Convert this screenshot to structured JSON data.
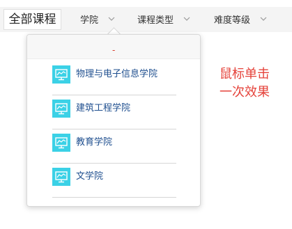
{
  "filter_bar": {
    "all_courses_label": "全部课程",
    "filters": [
      {
        "label": "学院"
      },
      {
        "label": "课程类型"
      },
      {
        "label": "难度等级"
      }
    ]
  },
  "dropdown": {
    "marker": "-",
    "options": [
      {
        "label": "物理与电子信息学院",
        "icon": "presentation-screen-icon"
      },
      {
        "label": "建筑工程学院",
        "icon": "presentation-screen-icon"
      },
      {
        "label": "教育学院",
        "icon": "presentation-screen-icon"
      },
      {
        "label": "文学院",
        "icon": "presentation-screen-icon"
      }
    ]
  },
  "annotation": {
    "line1": "鼠标单击",
    "line2": "一次效果"
  },
  "colors": {
    "icon_bg": "#3bd1e6",
    "option_text": "#1f4f8f",
    "annotation": "#e5423a",
    "marker": "#d93a2b"
  }
}
